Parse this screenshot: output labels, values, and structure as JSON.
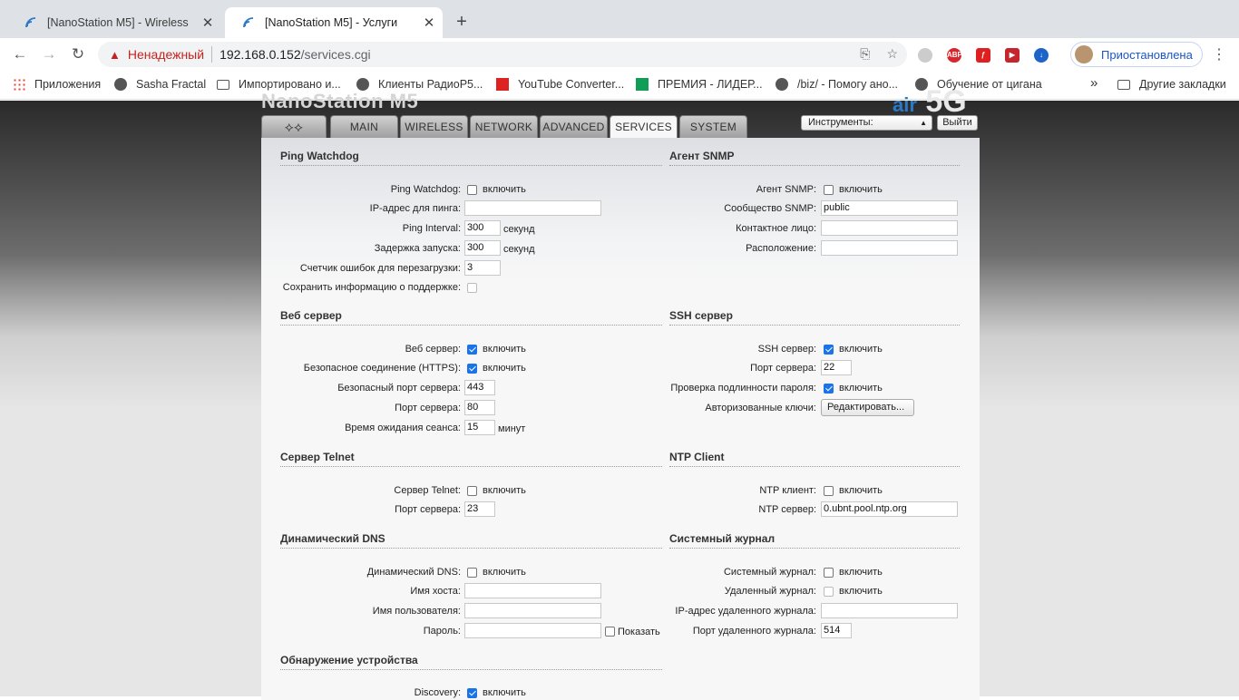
{
  "browser": {
    "tabs": [
      {
        "title": "[NanoStation M5] - Wireless",
        "active": false
      },
      {
        "title": "[NanoStation M5] - Услуги",
        "active": true
      }
    ],
    "new_tab": "+",
    "security_label": "Ненадежный",
    "url_host": "192.168.0.152",
    "url_path": "/services.cgi",
    "profile_label": "Приостановлена",
    "extensions": [
      "ABP"
    ],
    "bookmarks": [
      {
        "label": "Приложения",
        "icon": "apps-icon"
      },
      {
        "label": "Sasha Fractal",
        "icon": "globe-icon"
      },
      {
        "label": "Импортировано и...",
        "icon": "folder-icon"
      },
      {
        "label": "Клиенты РадиоР5...",
        "icon": "globe-icon"
      },
      {
        "label": "YouTube Converter...",
        "icon": "download-icon"
      },
      {
        "label": "ПРЕМИЯ - ЛИДЕР...",
        "icon": "sheet-icon"
      },
      {
        "label": "/biz/ - Помогу ано...",
        "icon": "globe-icon"
      },
      {
        "label": "Обучение от цигана",
        "icon": "globe-icon"
      }
    ],
    "bookmarks_more": "»",
    "other_bookmarks": "Другие закладки"
  },
  "header": {
    "brand": "NanoStation M5",
    "brand_right": "5G",
    "brand_right_prefix": "air",
    "tabs": [
      "MAIN",
      "WIRELESS",
      "NETWORK",
      "ADVANCED",
      "SERVICES",
      "SYSTEM"
    ],
    "active_tab": "SERVICES",
    "tools_select": "Инструменты:",
    "logout": "Выйти"
  },
  "ping_watchdog": {
    "title": "Ping Watchdog",
    "enable_label": "Ping Watchdog:",
    "enable_text": "включить",
    "enabled": false,
    "ip_label": "IP-адрес для пинга:",
    "ip_value": "",
    "interval_label": "Ping Interval:",
    "interval_value": "300",
    "interval_unit": "секунд",
    "delay_label": "Задержка запуска:",
    "delay_value": "300",
    "delay_unit": "секунд",
    "fail_label": "Счетчик ошибок для перезагрузки:",
    "fail_value": "3",
    "support_label": "Сохранить информацию о поддержке:"
  },
  "snmp": {
    "title": "Агент SNMP",
    "enable_label": "Агент SNMP:",
    "enable_text": "включить",
    "enabled": false,
    "community_label": "Сообщество SNMP:",
    "community_value": "public",
    "contact_label": "Контактное лицо:",
    "contact_value": "",
    "location_label": "Расположение:",
    "location_value": ""
  },
  "web": {
    "title": "Веб сервер",
    "enable_label": "Веб сервер:",
    "enable_text": "включить",
    "enabled": true,
    "https_label": "Безопасное соединение (HTTPS):",
    "https_text": "включить",
    "https_enabled": true,
    "secure_port_label": "Безопасный порт сервера:",
    "secure_port_value": "443",
    "port_label": "Порт сервера:",
    "port_value": "80",
    "timeout_label": "Время ожидания сеанса:",
    "timeout_value": "15",
    "timeout_unit": "минут"
  },
  "ssh": {
    "title": "SSH сервер",
    "enable_label": "SSH сервер:",
    "enable_text": "включить",
    "enabled": true,
    "port_label": "Порт сервера:",
    "port_value": "22",
    "pwauth_label": "Проверка подлинности пароля:",
    "pwauth_text": "включить",
    "pwauth_enabled": true,
    "keys_label": "Авторизованные ключи:",
    "keys_button": "Редактировать..."
  },
  "telnet": {
    "title": "Сервер Telnet",
    "enable_label": "Сервер Telnet:",
    "enable_text": "включить",
    "enabled": false,
    "port_label": "Порт сервера:",
    "port_value": "23"
  },
  "ntp": {
    "title": "NTP Client",
    "enable_label": "NTP клиент:",
    "enable_text": "включить",
    "enabled": false,
    "server_label": "NTP сервер:",
    "server_value": "0.ubnt.pool.ntp.org"
  },
  "ddns": {
    "title": "Динамический DNS",
    "enable_label": "Динамический DNS:",
    "enable_text": "включить",
    "enabled": false,
    "host_label": "Имя хоста:",
    "host_value": "",
    "user_label": "Имя пользователя:",
    "user_value": "",
    "pass_label": "Пароль:",
    "pass_value": "",
    "show_text": "Показать"
  },
  "syslog": {
    "title": "Системный журнал",
    "enable_label": "Системный журнал:",
    "enable_text": "включить",
    "enabled": false,
    "remote_label": "Удаленный журнал:",
    "remote_text": "включить",
    "remote_ip_label": "IP-адрес удаленного журнала:",
    "remote_ip_value": "",
    "remote_port_label": "Порт удаленного журнала:",
    "remote_port_value": "514"
  },
  "discovery": {
    "title": "Обнаружение устройства",
    "enable_label": "Discovery:",
    "enable_text": "включить",
    "enabled": true
  }
}
